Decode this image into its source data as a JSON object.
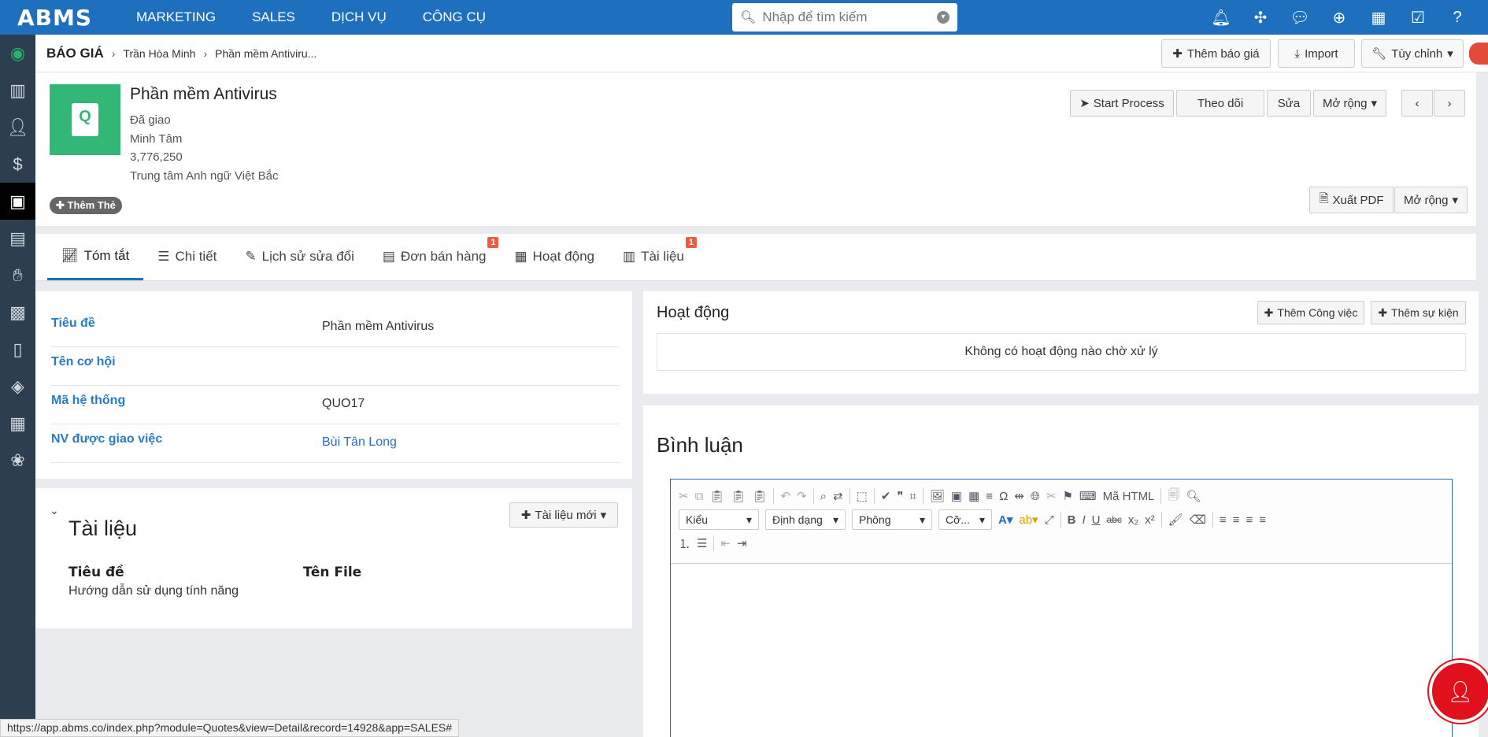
{
  "app": {
    "logo": "ABMS",
    "menu": [
      "MARKETING",
      "SALES",
      "DỊCH VỤ",
      "CÔNG CỤ"
    ],
    "search_placeholder": "Nhập để tìm kiếm"
  },
  "breadcrumb": {
    "root": "BÁO GIÁ",
    "items": [
      "Trần Hòa Minh",
      "Phần mềm Antiviru..."
    ]
  },
  "header_buttons": {
    "add_quote": "Thêm báo giá",
    "import": "Import",
    "customize": "Tùy chỉnh"
  },
  "record": {
    "title": "Phần mềm Antivirus",
    "status": "Đã giao",
    "owner": "Minh Tâm",
    "amount": " 3,776,250",
    "organization": "Trung tâm Anh ngữ Việt Bắc",
    "add_tag": "Thêm Thẻ",
    "actions": {
      "start_process": "Start Process",
      "follow": "Theo dõi",
      "edit": "Sửa",
      "expand": "Mở rộng",
      "export_pdf": "Xuất PDF",
      "expand2": "Mở rộng"
    }
  },
  "tabs": [
    {
      "label": "Tóm tắt",
      "badge": ""
    },
    {
      "label": "Chi tiết",
      "badge": ""
    },
    {
      "label": "Lịch sử sửa đổi",
      "badge": ""
    },
    {
      "label": "Đơn bán hàng",
      "badge": "1"
    },
    {
      "label": "Hoạt động",
      "badge": ""
    },
    {
      "label": "Tài liệu",
      "badge": "1"
    }
  ],
  "summary": {
    "fields": [
      {
        "label": "Tiêu đề",
        "value": "Phần mềm Antivirus"
      },
      {
        "label": "Tên cơ hội",
        "value": ""
      },
      {
        "label": "Mã hệ thống",
        "value": "QUO17"
      },
      {
        "label": "NV được giao việc",
        "value": "Bùi Tân Long"
      }
    ]
  },
  "documents": {
    "title": "Tài liệu",
    "new_button": "Tài liệu mới",
    "columns": [
      "Tiêu đề",
      "Tên File"
    ],
    "rows": [
      [
        "Hướng dẫn sử dụng tính năng",
        ""
      ]
    ]
  },
  "activity": {
    "title": "Hoạt động",
    "add_task": "Thêm Công việc",
    "add_event": "Thêm sự kiện",
    "empty": "Không có hoạt động nào chờ xử lý"
  },
  "comments": {
    "title": "Bình luận",
    "toolbar": {
      "html_source": "Mã HTML",
      "style": "Kiểu",
      "format": "Định dạng",
      "font": "Phông",
      "size": "Cỡ..."
    }
  },
  "status_url": "https://app.abms.co/index.php?module=Quotes&view=Detail&record=14928&app=SALES#",
  "colors": {
    "nav": "#1f6fbf",
    "sidebar": "#2d3e50",
    "record_icon": "#33b777",
    "badge": "#f15a3c"
  }
}
